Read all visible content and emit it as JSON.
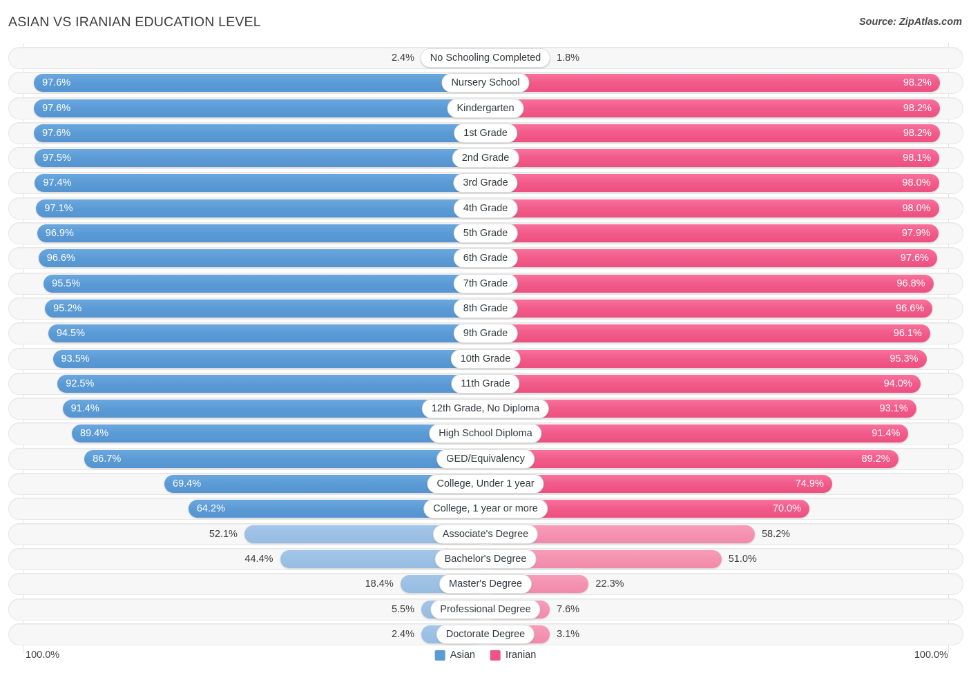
{
  "header": {
    "title": "ASIAN VS IRANIAN EDUCATION LEVEL",
    "source": "Source: ZipAtlas.com"
  },
  "footer": {
    "axis_left": "100.0%",
    "axis_right": "100.0%",
    "legend": [
      {
        "label": "Asian",
        "color": "#5b9bd5",
        "swatch": "asian-swatch"
      },
      {
        "label": "Iranian",
        "color": "#ef5487",
        "swatch": "iranian-swatch"
      }
    ]
  },
  "chart_data": {
    "type": "bar",
    "title": "ASIAN VS IRANIAN EDUCATION LEVEL",
    "orientation": "horizontal-diverging",
    "xlabel": "",
    "ylabel": "",
    "xlim": [
      0,
      100
    ],
    "grid": true,
    "legend_position": "bottom-center",
    "categories": [
      "No Schooling Completed",
      "Nursery School",
      "Kindergarten",
      "1st Grade",
      "2nd Grade",
      "3rd Grade",
      "4th Grade",
      "5th Grade",
      "6th Grade",
      "7th Grade",
      "8th Grade",
      "9th Grade",
      "10th Grade",
      "11th Grade",
      "12th Grade, No Diploma",
      "High School Diploma",
      "GED/Equivalency",
      "College, Under 1 year",
      "College, 1 year or more",
      "Associate's Degree",
      "Bachelor's Degree",
      "Master's Degree",
      "Professional Degree",
      "Doctorate Degree"
    ],
    "series": [
      {
        "name": "Asian",
        "color": "#5b9bd5",
        "values": [
          2.4,
          97.6,
          97.6,
          97.6,
          97.5,
          97.4,
          97.1,
          96.9,
          96.6,
          95.5,
          95.2,
          94.5,
          93.5,
          92.5,
          91.4,
          89.4,
          86.7,
          69.4,
          64.2,
          52.1,
          44.4,
          18.4,
          5.5,
          2.4
        ],
        "labels": [
          "2.4%",
          "97.6%",
          "97.6%",
          "97.6%",
          "97.5%",
          "97.4%",
          "97.1%",
          "96.9%",
          "96.6%",
          "95.5%",
          "95.2%",
          "94.5%",
          "93.5%",
          "92.5%",
          "91.4%",
          "89.4%",
          "86.7%",
          "69.4%",
          "64.2%",
          "52.1%",
          "44.4%",
          "18.4%",
          "5.5%",
          "2.4%"
        ]
      },
      {
        "name": "Iranian",
        "color": "#ef5487",
        "values": [
          1.8,
          98.2,
          98.2,
          98.2,
          98.1,
          98.0,
          98.0,
          97.9,
          97.6,
          96.8,
          96.6,
          96.1,
          95.3,
          94.0,
          93.1,
          91.4,
          89.2,
          74.9,
          70.0,
          58.2,
          51.0,
          22.3,
          7.6,
          3.1
        ],
        "labels": [
          "1.8%",
          "98.2%",
          "98.2%",
          "98.2%",
          "98.1%",
          "98.0%",
          "98.0%",
          "97.9%",
          "97.6%",
          "96.8%",
          "96.6%",
          "96.1%",
          "95.3%",
          "94.0%",
          "93.1%",
          "91.4%",
          "89.2%",
          "74.9%",
          "70.0%",
          "58.2%",
          "51.0%",
          "22.3%",
          "7.6%",
          "3.1%"
        ]
      }
    ]
  }
}
